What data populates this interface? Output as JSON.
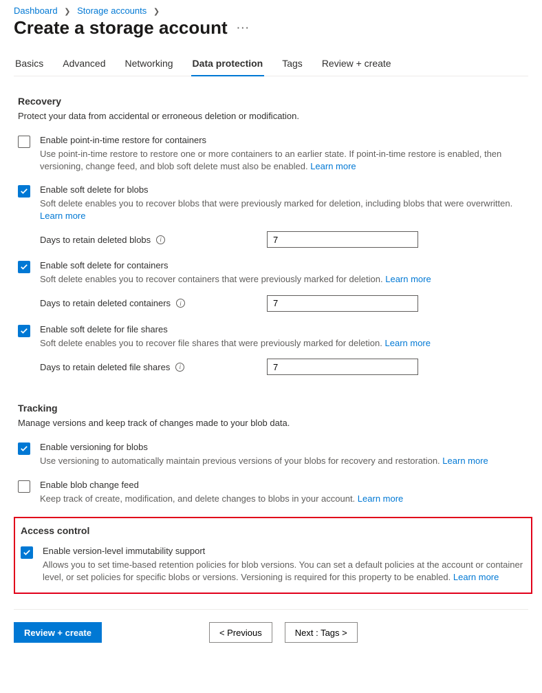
{
  "breadcrumb": {
    "items": [
      "Dashboard",
      "Storage accounts"
    ]
  },
  "title": "Create a storage account",
  "tabs": [
    "Basics",
    "Advanced",
    "Networking",
    "Data protection",
    "Tags",
    "Review + create"
  ],
  "active_tab_index": 3,
  "recovery": {
    "heading": "Recovery",
    "desc": "Protect your data from accidental or erroneous deletion or modification.",
    "pitr": {
      "label": "Enable point-in-time restore for containers",
      "help": "Use point-in-time restore to restore one or more containers to an earlier state. If point-in-time restore is enabled, then versioning, change feed, and blob soft delete must also be enabled.",
      "learn": "Learn more",
      "checked": false
    },
    "soft_blobs": {
      "label": "Enable soft delete for blobs",
      "help": "Soft delete enables you to recover blobs that were previously marked for deletion, including blobs that were overwritten.",
      "learn": "Learn more",
      "checked": true,
      "field_label": "Days to retain deleted blobs",
      "field_value": "7"
    },
    "soft_containers": {
      "label": "Enable soft delete for containers",
      "help": "Soft delete enables you to recover containers that were previously marked for deletion.",
      "learn": "Learn more",
      "checked": true,
      "field_label": "Days to retain deleted containers",
      "field_value": "7"
    },
    "soft_fileshares": {
      "label": "Enable soft delete for file shares",
      "help": "Soft delete enables you to recover file shares that were previously marked for deletion.",
      "learn": "Learn more",
      "checked": true,
      "field_label": "Days to retain deleted file shares",
      "field_value": "7"
    }
  },
  "tracking": {
    "heading": "Tracking",
    "desc": "Manage versions and keep track of changes made to your blob data.",
    "versioning": {
      "label": "Enable versioning for blobs",
      "help": "Use versioning to automatically maintain previous versions of your blobs for recovery and restoration.",
      "learn": "Learn more",
      "checked": true
    },
    "changefeed": {
      "label": "Enable blob change feed",
      "help": "Keep track of create, modification, and delete changes to blobs in your account.",
      "learn": "Learn more",
      "checked": false
    }
  },
  "access": {
    "heading": "Access control",
    "immutability": {
      "label": "Enable version-level immutability support",
      "help": "Allows you to set time-based retention policies for blob versions. You can set a default policies at the account or container level, or set policies for specific blobs or versions. Versioning is required for this property to be enabled.",
      "learn": "Learn more",
      "checked": true
    }
  },
  "footer": {
    "review": "Review + create",
    "prev": "<  Previous",
    "next": "Next : Tags  >"
  }
}
